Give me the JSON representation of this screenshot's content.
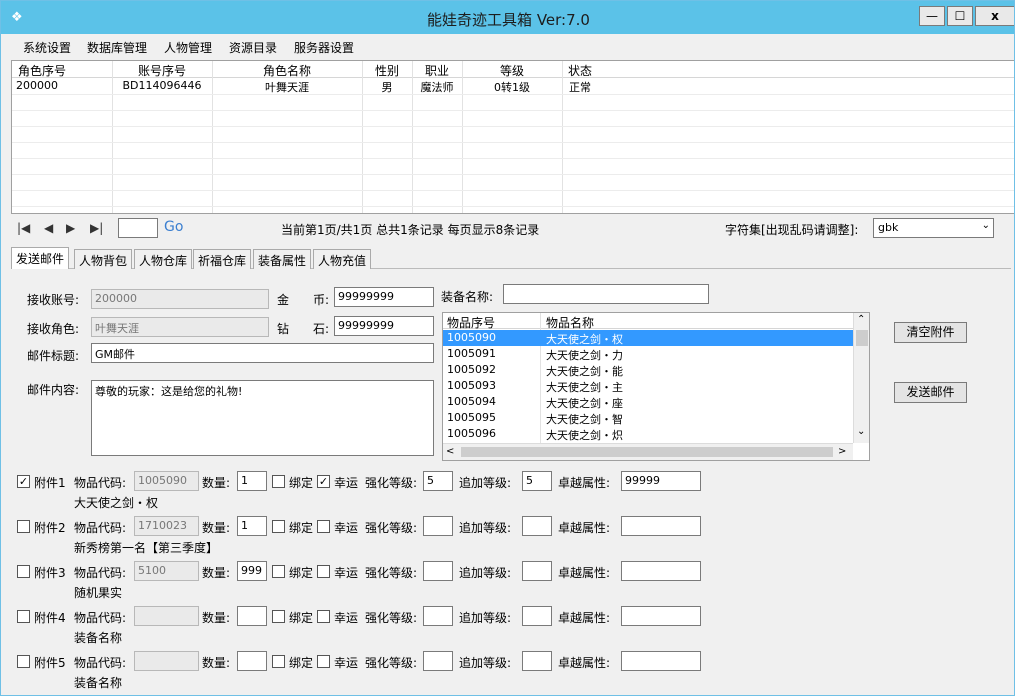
{
  "window": {
    "title": "能娃奇迹工具箱 Ver:7.0",
    "min": "—",
    "max": "☐",
    "close": "x"
  },
  "menu": [
    "系统设置",
    "数据库管理",
    "人物管理",
    "资源目录",
    "服务器设置"
  ],
  "grid": {
    "columns": [
      "角色序号",
      "账号序号",
      "角色名称",
      "性别",
      "职业",
      "等级",
      "状态"
    ],
    "rows": [
      [
        "200000",
        "BD114096446",
        "叶舞天涯",
        "男",
        "魔法师",
        "0转1级",
        "正常"
      ]
    ]
  },
  "pager": {
    "page_value": "",
    "go": "Go",
    "info": "当前第1页/共1页  总共1条记录  每页显示8条记录",
    "charset_label": "字符集[出现乱码请调整]:",
    "charset_value": "gbk"
  },
  "tabs": [
    "发送邮件",
    "人物背包",
    "人物仓库",
    "祈福仓库",
    "装备属性",
    "人物充值"
  ],
  "mail": {
    "recv_account_label": "接收账号:",
    "recv_account": "200000",
    "recv_role_label": "接收角色:",
    "recv_role": "叶舞天涯",
    "subject_label": "邮件标题:",
    "subject": "GM邮件",
    "content_label": "邮件内容:",
    "content": "尊敬的玩家：这是给您的礼物!",
    "gold_label_a": "金",
    "gold_label_b": "币:",
    "gold": "99999999",
    "diamond_label_a": "钻",
    "diamond_label_b": "石:",
    "diamond": "99999999",
    "equip_name_label": "装备名称:",
    "equip_name": "",
    "clear_button": "清空附件",
    "send_button": "发送邮件"
  },
  "item_list": {
    "columns": [
      "物品序号",
      "物品名称"
    ],
    "rows": [
      [
        "1005090",
        "大天使之剑・权"
      ],
      [
        "1005091",
        "大天使之剑・力"
      ],
      [
        "1005092",
        "大天使之剑・能"
      ],
      [
        "1005093",
        "大天使之剑・主"
      ],
      [
        "1005094",
        "大天使之剑・座"
      ],
      [
        "1005095",
        "大天使之剑・智"
      ],
      [
        "1005096",
        "大天使之剑・炽"
      ]
    ],
    "selected": 0
  },
  "attach_labels": {
    "code": "物品代码:",
    "qty": "数量:",
    "bind": "绑定",
    "luck": "幸运",
    "enhance": "强化等级:",
    "add": "追加等级:",
    "excellent": "卓越属性:"
  },
  "attachments": [
    {
      "label": "附件1",
      "checked": true,
      "code": "1005090",
      "qty": "1",
      "bind": false,
      "luck": true,
      "enhance": "5",
      "add": "5",
      "excellent": "99999",
      "name": "大天使之剑・权"
    },
    {
      "label": "附件2",
      "checked": false,
      "code": "1710023",
      "qty": "1",
      "bind": false,
      "luck": false,
      "enhance": "",
      "add": "",
      "excellent": "",
      "name": "新秀榜第一名【第三季度】"
    },
    {
      "label": "附件3",
      "checked": false,
      "code": "5100",
      "qty": "999",
      "bind": false,
      "luck": false,
      "enhance": "",
      "add": "",
      "excellent": "",
      "name": "随机果实"
    },
    {
      "label": "附件4",
      "checked": false,
      "code": "",
      "qty": "",
      "bind": false,
      "luck": false,
      "enhance": "",
      "add": "",
      "excellent": "",
      "name": "装备名称"
    },
    {
      "label": "附件5",
      "checked": false,
      "code": "",
      "qty": "",
      "bind": false,
      "luck": false,
      "enhance": "",
      "add": "",
      "excellent": "",
      "name": "装备名称"
    }
  ]
}
